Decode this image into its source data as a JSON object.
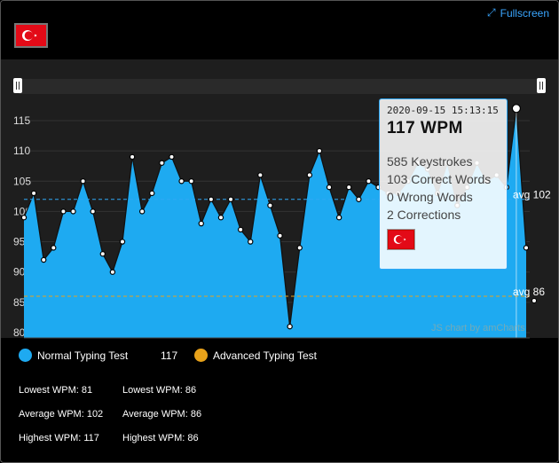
{
  "header": {
    "fullscreen_label": "Fullscreen",
    "flag_alt": "Turkey"
  },
  "chart_data": {
    "type": "area",
    "y_ticks": [
      80,
      85,
      90,
      95,
      100,
      105,
      110,
      115
    ],
    "ylim": [
      80,
      119
    ],
    "series": [
      {
        "name": "Normal Typing Test",
        "color": "#1eaaf1",
        "values": [
          99,
          103,
          92,
          94,
          100,
          100,
          105,
          100,
          93,
          90,
          95,
          109,
          100,
          103,
          108,
          109,
          105,
          105,
          98,
          102,
          99,
          102,
          97,
          95,
          106,
          101,
          96,
          81,
          94,
          106,
          110,
          104,
          99,
          104,
          102,
          105,
          104,
          103,
          103,
          105,
          108,
          107,
          103,
          108,
          101,
          104,
          108,
          105,
          106,
          104,
          117,
          94
        ]
      }
    ],
    "guides": [
      {
        "value": 102,
        "label": "avg 102",
        "color": "#2ea8f5"
      },
      {
        "value": 86,
        "label": "avg 86",
        "color": "#e8a21a"
      }
    ],
    "tooltip": {
      "date": "2020-09-15 15:13:15",
      "wpm": "117 WPM",
      "keystrokes": "585 Keystrokes",
      "correct": "103 Correct Words",
      "wrong": "0 Wrong Words",
      "corrections": "2 Corrections"
    },
    "credit": "JS chart by amCharts"
  },
  "legend": [
    {
      "label": "Normal Typing Test",
      "value": "117",
      "color": "#1eaaf1"
    },
    {
      "label": "Advanced Typing Test",
      "value": "",
      "color": "#e8a21a"
    }
  ],
  "stats": {
    "normal": {
      "lowest": "Lowest WPM: 81",
      "average": "Average WPM: 102",
      "highest": "Highest WPM: 117"
    },
    "advanced": {
      "lowest": "Lowest WPM: 86",
      "average": "Average WPM: 86",
      "highest": "Highest WPM: 86"
    }
  }
}
